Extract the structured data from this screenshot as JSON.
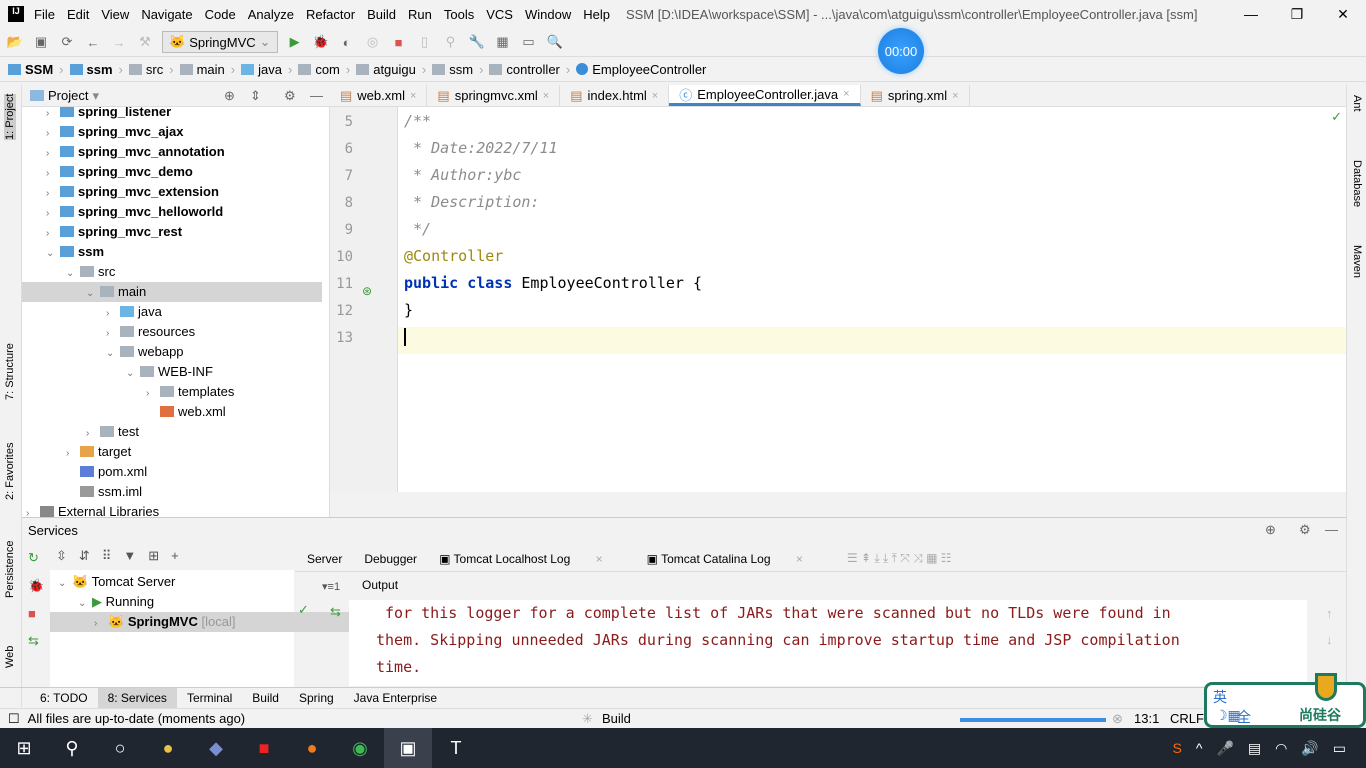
{
  "window": {
    "title": "SSM [D:\\IDEA\\workspace\\SSM] - ...\\java\\com\\atguigu\\ssm\\controller\\EmployeeController.java [ssm]",
    "logo": "IJ"
  },
  "menu": [
    "File",
    "Edit",
    "View",
    "Navigate",
    "Code",
    "Analyze",
    "Refactor",
    "Build",
    "Run",
    "Tools",
    "VCS",
    "Window",
    "Help"
  ],
  "toolbar": {
    "run_config": "SpringMVC"
  },
  "timer": "00:00",
  "breadcrumb": [
    "SSM",
    "ssm",
    "src",
    "main",
    "java",
    "com",
    "atguigu",
    "ssm",
    "controller",
    "EmployeeController"
  ],
  "left_strip": [
    "1: Project",
    "7: Structure",
    "2: Favorites",
    "Persistence",
    "Web"
  ],
  "right_strip": [
    "Ant",
    "Database",
    "Maven"
  ],
  "project": {
    "title": "Project",
    "tree": [
      {
        "label": "spring_listener",
        "level": 1,
        "arrow": "right",
        "bold": true,
        "type": "module"
      },
      {
        "label": "spring_mvc_ajax",
        "level": 1,
        "arrow": "right",
        "bold": true,
        "type": "module"
      },
      {
        "label": "spring_mvc_annotation",
        "level": 1,
        "arrow": "right",
        "bold": true,
        "type": "module"
      },
      {
        "label": "spring_mvc_demo",
        "level": 1,
        "arrow": "right",
        "bold": true,
        "type": "module"
      },
      {
        "label": "spring_mvc_extension",
        "level": 1,
        "arrow": "right",
        "bold": true,
        "type": "module"
      },
      {
        "label": "spring_mvc_helloworld",
        "level": 1,
        "arrow": "right",
        "bold": true,
        "type": "module"
      },
      {
        "label": "spring_mvc_rest",
        "level": 1,
        "arrow": "right",
        "bold": true,
        "type": "module"
      },
      {
        "label": "ssm",
        "level": 1,
        "arrow": "down",
        "bold": true,
        "type": "module"
      },
      {
        "label": "src",
        "level": 2,
        "arrow": "down",
        "type": "folder"
      },
      {
        "label": "main",
        "level": 3,
        "arrow": "down",
        "type": "folder",
        "selected": true
      },
      {
        "label": "java",
        "level": 4,
        "arrow": "right",
        "type": "src"
      },
      {
        "label": "resources",
        "level": 4,
        "arrow": "right",
        "type": "folder"
      },
      {
        "label": "webapp",
        "level": 4,
        "arrow": "down",
        "type": "folder"
      },
      {
        "label": "WEB-INF",
        "level": 5,
        "arrow": "down",
        "type": "folder"
      },
      {
        "label": "templates",
        "level": 6,
        "arrow": "right",
        "type": "folder"
      },
      {
        "label": "web.xml",
        "level": 6,
        "arrow": "",
        "type": "xml"
      },
      {
        "label": "test",
        "level": 3,
        "arrow": "right",
        "type": "folder"
      },
      {
        "label": "target",
        "level": 2,
        "arrow": "right",
        "type": "target"
      },
      {
        "label": "pom.xml",
        "level": 2,
        "arrow": "",
        "type": "maven"
      },
      {
        "label": "ssm.iml",
        "level": 2,
        "arrow": "",
        "type": "iml"
      },
      {
        "label": "External Libraries",
        "level": 0,
        "arrow": "right",
        "type": "lib"
      }
    ]
  },
  "tabs": [
    {
      "label": "web.xml"
    },
    {
      "label": "springmvc.xml"
    },
    {
      "label": "index.html"
    },
    {
      "label": "EmployeeController.java",
      "active": true
    },
    {
      "label": "spring.xml"
    }
  ],
  "code": [
    {
      "n": "5",
      "t": "/**",
      "c": "cmt"
    },
    {
      "n": "6",
      "t": " * Date:2022/7/11",
      "c": "cmt"
    },
    {
      "n": "7",
      "t": " * Author:ybc",
      "c": "cmt"
    },
    {
      "n": "8",
      "t": " * Description:",
      "c": "cmt"
    },
    {
      "n": "9",
      "t": " */",
      "c": "cmt"
    },
    {
      "n": "10",
      "t": "@Controller",
      "c": "ann"
    },
    {
      "n": "11",
      "kw": "public class ",
      "t": "EmployeeController {",
      "c": ""
    },
    {
      "n": "12",
      "t": "}",
      "c": ""
    },
    {
      "n": "13",
      "t": "",
      "c": "",
      "current": true
    }
  ],
  "services": {
    "title": "Services",
    "tree": [
      {
        "label": "Tomcat Server"
      },
      {
        "label": "Running"
      },
      {
        "label": "SpringMVC",
        "suffix": "[local]"
      }
    ],
    "tabs": [
      "Server",
      "Debugger",
      "Tomcat Localhost Log",
      "Tomcat Catalina Log"
    ],
    "output_label": "Output",
    "output": [
      " for this logger for a complete list of JARs that were scanned but no TLDs were found in",
      "them. Skipping unneeded JARs during scanning can improve startup time and JSP compilation",
      "time."
    ]
  },
  "bottom_tabs": [
    {
      "label": "6: TODO"
    },
    {
      "label": "8: Services",
      "active": true
    },
    {
      "label": "Terminal"
    },
    {
      "label": "Build"
    },
    {
      "label": "Spring"
    },
    {
      "label": "Java Enterprise"
    }
  ],
  "status": {
    "message": "All files are up-to-date (moments ago)",
    "task": "Build",
    "position": "13:1",
    "line_sep": "CRLF"
  },
  "ime": {
    "lang": "英",
    "mode": "全",
    "brand": "尚硅谷"
  },
  "colors": {
    "accent": "#4083c9",
    "comment": "#8c8c8c",
    "annotation": "#9e880d",
    "keyword": "#0033b3",
    "output": "#8b1a1a"
  }
}
